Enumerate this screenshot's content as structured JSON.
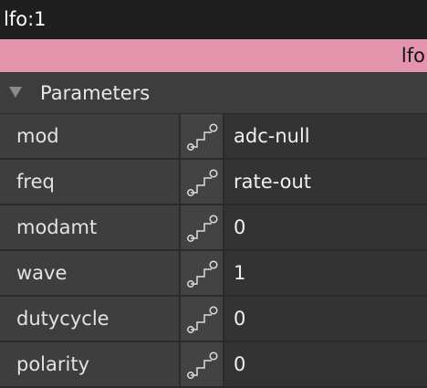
{
  "window": {
    "title": "lfo:1"
  },
  "accent_bar": {
    "label": "lfo",
    "color": "#e494ad"
  },
  "section": {
    "title": "Parameters",
    "expanded": true,
    "icon": "triangle-down-icon"
  },
  "parameters": [
    {
      "name": "mod",
      "value": "adc-null",
      "icon": "patch-connector-icon"
    },
    {
      "name": "freq",
      "value": "rate-out",
      "icon": "patch-connector-icon"
    },
    {
      "name": "modamt",
      "value": "0",
      "icon": "patch-connector-icon"
    },
    {
      "name": "wave",
      "value": "1",
      "icon": "patch-connector-icon"
    },
    {
      "name": "dutycycle",
      "value": "0",
      "icon": "patch-connector-icon"
    },
    {
      "name": "polarity",
      "value": "0",
      "icon": "patch-connector-icon"
    }
  ]
}
